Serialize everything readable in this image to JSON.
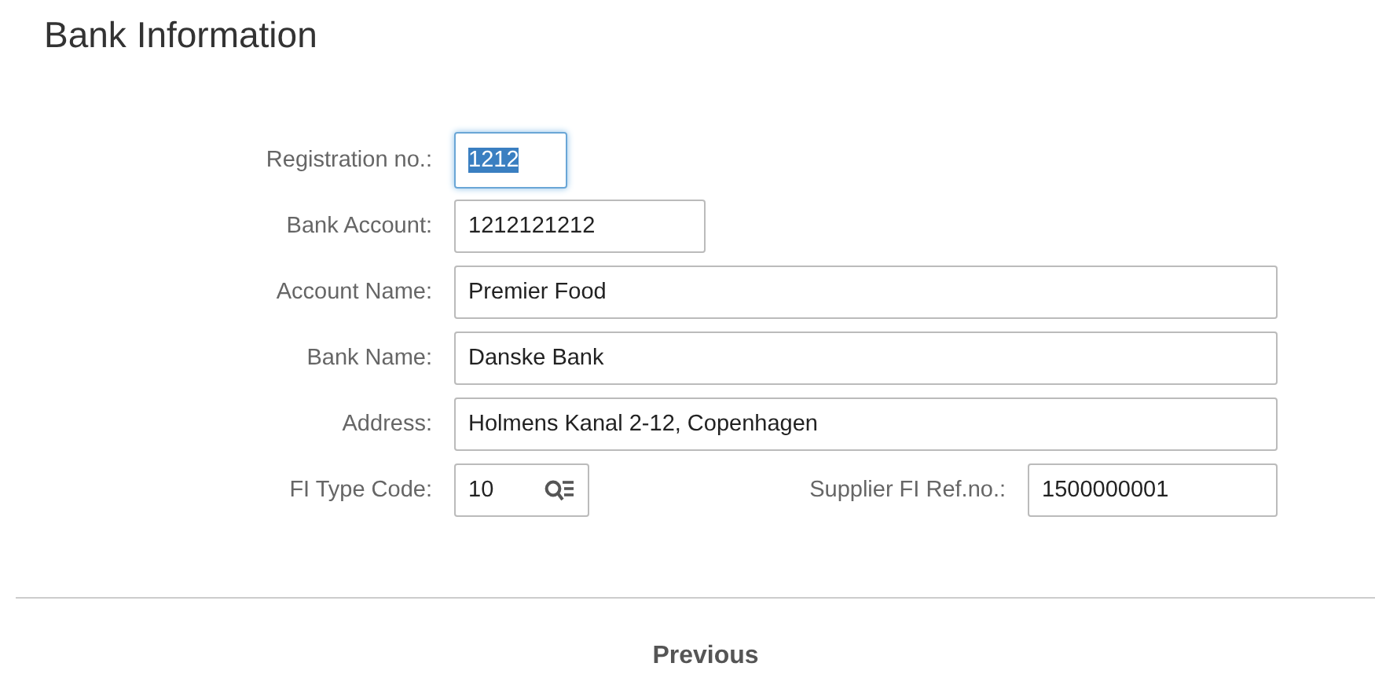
{
  "title": "Bank Information",
  "rows": [
    {
      "label": "Registration no.:",
      "value": "1212",
      "kind": "narrow",
      "focused": true
    },
    {
      "label": "Bank Account:",
      "value": "1212121212",
      "kind": "medium",
      "focused": false
    },
    {
      "label": "Account Name:",
      "value": "Premier Food",
      "kind": "wide",
      "focused": false
    },
    {
      "label": "Bank Name:",
      "value": "Danske Bank",
      "kind": "wide",
      "focused": false
    },
    {
      "label": "Address:",
      "value": "Holmens Kanal 2-12, Copenhagen",
      "kind": "wide",
      "focused": false
    }
  ],
  "fi_type": {
    "label": "FI Type Code:",
    "value": "10"
  },
  "supplier_ref": {
    "label": "Supplier FI Ref.no.:",
    "value": "1500000001"
  },
  "previous_button": "Previous"
}
